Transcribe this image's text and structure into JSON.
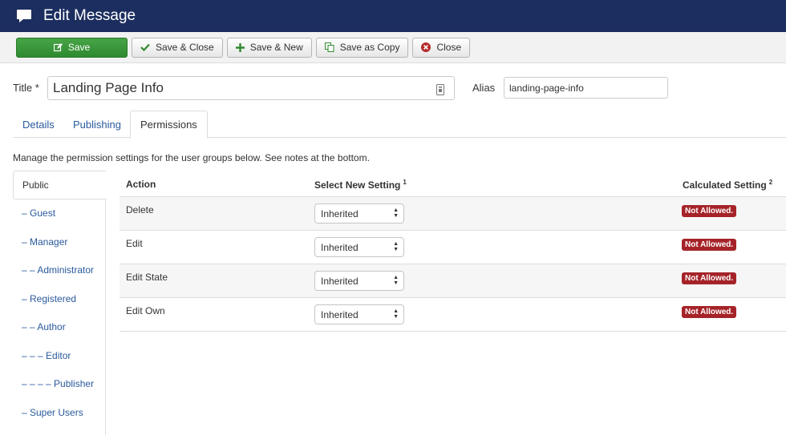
{
  "header": {
    "title": "Edit Message",
    "icon": "message-icon"
  },
  "toolbar": {
    "save": "Save",
    "save_close": "Save & Close",
    "save_new": "Save & New",
    "save_copy": "Save as Copy",
    "close": "Close"
  },
  "form": {
    "title_label": "Title *",
    "title_value": "Landing Page Info",
    "alias_label": "Alias",
    "alias_value": "landing-page-info"
  },
  "tabs": [
    "Details",
    "Publishing",
    "Permissions"
  ],
  "active_tab": "Permissions",
  "intro": "Manage the permission settings for the user groups below. See notes at the bottom.",
  "groups": [
    "Public",
    "– Guest",
    "– Manager",
    "– – Administrator",
    "– Registered",
    "– – Author",
    "– – – Editor",
    "– – – – Publisher",
    "– Super Users"
  ],
  "permissions": {
    "col_action": "Action",
    "col_setting": "Select New Setting",
    "col_setting_note": "1",
    "col_calc": "Calculated Setting",
    "col_calc_note": "2",
    "rows": [
      {
        "action": "Delete",
        "setting": "Inherited",
        "calc": "Not Allowed."
      },
      {
        "action": "Edit",
        "setting": "Inherited",
        "calc": "Not Allowed."
      },
      {
        "action": "Edit State",
        "setting": "Inherited",
        "calc": "Not Allowed."
      },
      {
        "action": "Edit Own",
        "setting": "Inherited",
        "calc": "Not Allowed."
      }
    ]
  },
  "colors": {
    "header_bg": "#1c2e5f",
    "save_green": "#3c983c",
    "badge_red": "#a52328",
    "link_blue": "#2a5a9c"
  }
}
